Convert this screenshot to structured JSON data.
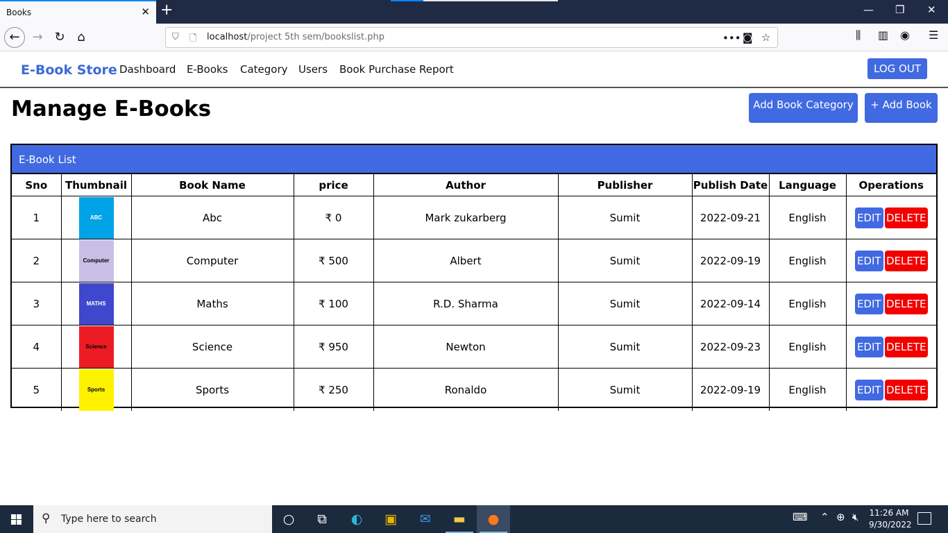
{
  "browser": {
    "tab_title": "Books",
    "tab_close": "✕",
    "new_tab": "+",
    "minimize": "—",
    "restore": "❐",
    "close": "✕",
    "url_host": "localhost",
    "url_path": "/project 5th sem/bookslist.php",
    "page_actions": "•••"
  },
  "site": {
    "brand": "E-Book Store",
    "menu": [
      "Dashboard",
      "E-Books",
      "Category",
      "Users",
      "Book Purchase Report"
    ],
    "logout": "LOG OUT"
  },
  "page": {
    "title": "Manage E-Books",
    "add_category": "Add Book Category",
    "add_book": "+ Add Book",
    "list_title": "E-Book List"
  },
  "table": {
    "columns": [
      "Sno",
      "Thumbnail",
      "Book Name",
      "price",
      "Author",
      "Publisher",
      "Publish Date",
      "Language",
      "Operations"
    ],
    "rows": [
      {
        "sno": "1",
        "thumb_text": "ABC",
        "thumb_bg": "#00a2e8",
        "thumb_fg": "#ffffff",
        "name": "Abc",
        "price": "₹ 0",
        "author": "Mark zukarberg",
        "publisher": "Sumit",
        "date": "2022-09-21",
        "language": "English"
      },
      {
        "sno": "2",
        "thumb_text": "Computer",
        "thumb_bg": "#c8bfe7",
        "thumb_fg": "#000000",
        "name": "Computer",
        "price": "₹ 500",
        "author": "Albert",
        "publisher": "Sumit",
        "date": "2022-09-19",
        "language": "English"
      },
      {
        "sno": "3",
        "thumb_text": "MATHS",
        "thumb_bg": "#3f48cc",
        "thumb_fg": "#ffffff",
        "name": "Maths",
        "price": "₹ 100",
        "author": "R.D. Sharma",
        "publisher": "Sumit",
        "date": "2022-09-14",
        "language": "English"
      },
      {
        "sno": "4",
        "thumb_text": "Science",
        "thumb_bg": "#ed1c24",
        "thumb_fg": "#000000",
        "name": "Science",
        "price": "₹ 950",
        "author": "Newton",
        "publisher": "Sumit",
        "date": "2022-09-23",
        "language": "English"
      },
      {
        "sno": "5",
        "thumb_text": "Sports",
        "thumb_bg": "#fff200",
        "thumb_fg": "#000000",
        "name": "Sports",
        "price": "₹ 250",
        "author": "Ronaldo",
        "publisher": "Sumit",
        "date": "2022-09-19",
        "language": "English"
      }
    ],
    "edit_label": "EDIT",
    "delete_label": "DELETE"
  },
  "taskbar": {
    "search_placeholder": "Type here to search",
    "time": "11:26 AM",
    "date": "9/30/2022"
  },
  "colors": {
    "accent": "#4169e1",
    "danger": "#f20000",
    "brand_text": "#3d6ad6"
  }
}
